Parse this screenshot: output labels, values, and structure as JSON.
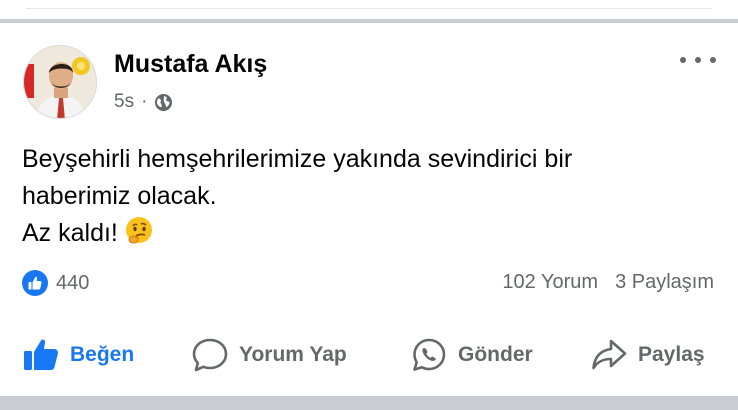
{
  "post": {
    "author": "Mustafa Akış",
    "time": "5s",
    "separator": "·",
    "privacy_icon": "globe-icon",
    "text_lines": [
      "Beyşehirli hemşehrilerimize yakında sevindirici bir",
      "haberimiz olacak.",
      "Az kaldı!"
    ],
    "emoji": "thinking-face-emoji"
  },
  "stats": {
    "reaction_count": "440",
    "comments": "102 Yorum",
    "shares": "3 Paylaşım"
  },
  "actions": {
    "like": "Beğen",
    "comment": "Yorum Yap",
    "send": "Gönder",
    "share": "Paylaş"
  },
  "colors": {
    "accent": "#1877f2",
    "secondary_text": "#65676b",
    "divider": "#c9ccd1"
  }
}
